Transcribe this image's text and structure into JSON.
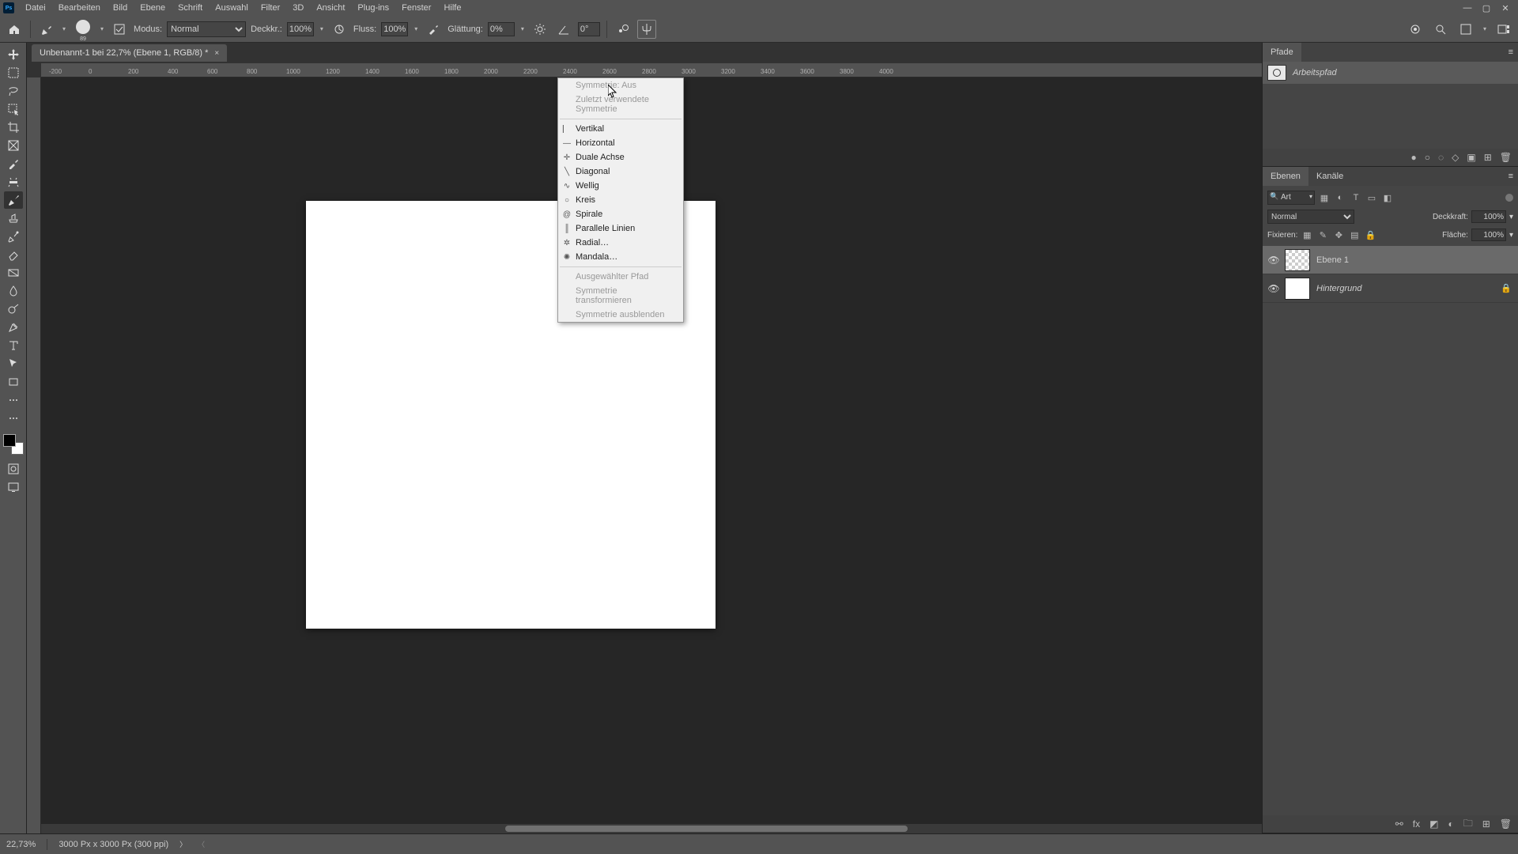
{
  "menubar": {
    "items": [
      "Datei",
      "Bearbeiten",
      "Bild",
      "Ebene",
      "Schrift",
      "Auswahl",
      "Filter",
      "3D",
      "Ansicht",
      "Plug-ins",
      "Fenster",
      "Hilfe"
    ]
  },
  "options": {
    "brush_size": "89",
    "modus_label": "Modus:",
    "modus_value": "Normal",
    "deckkr_label": "Deckkr.:",
    "deckkr_value": "100%",
    "fluss_label": "Fluss:",
    "fluss_value": "100%",
    "glaettung_label": "Glättung:",
    "glaettung_value": "0%",
    "angle_value": "0°"
  },
  "doc_tab": {
    "title": "Unbenannt-1 bei 22,7% (Ebene 1, RGB/8) *"
  },
  "ruler_h": [
    "-200",
    "0",
    "200",
    "400",
    "600",
    "800",
    "1000",
    "1200",
    "1400",
    "1600",
    "1800",
    "2000",
    "2200",
    "2400",
    "2600",
    "2800",
    "3000",
    "3200",
    "3400",
    "3600",
    "3800",
    "4000"
  ],
  "sym_menu": {
    "off": "Symmetrie: Aus",
    "recent": "Zuletzt verwendete Symmetrie",
    "items": [
      "Vertikal",
      "Horizontal",
      "Duale Achse",
      "Diagonal",
      "Wellig",
      "Kreis",
      "Spirale",
      "Parallele Linien",
      "Radial…",
      "Mandala…"
    ],
    "footer": [
      "Ausgewählter Pfad",
      "Symmetrie transformieren",
      "Symmetrie ausblenden"
    ]
  },
  "pfade": {
    "tab": "Pfade",
    "item_name": "Arbeitspfad"
  },
  "ebenen": {
    "tab_ebenen": "Ebenen",
    "tab_kanaele": "Kanäle",
    "filter_kind": "Art",
    "mode_value": "Normal",
    "opacity_label": "Deckkraft:",
    "opacity_value": "100%",
    "lock_label": "Fixieren:",
    "fill_label": "Fläche:",
    "fill_value": "100%",
    "layers": [
      {
        "name": "Ebene 1",
        "locked": false,
        "transparent": true
      },
      {
        "name": "Hintergrund",
        "locked": true,
        "transparent": false
      }
    ]
  },
  "status": {
    "zoom": "22,73%",
    "doc": "3000 Px x 3000 Px (300 ppi)"
  }
}
